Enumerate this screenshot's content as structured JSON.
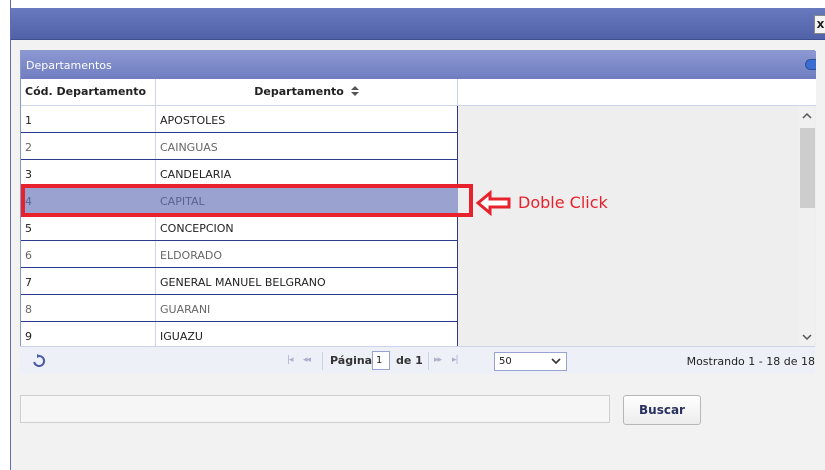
{
  "window": {
    "close_label": "x"
  },
  "grid": {
    "caption": "Departamentos",
    "columns": {
      "code": "Cód. Departamento",
      "name": "Departamento"
    },
    "rows": [
      {
        "code": "1",
        "name": "APOSTOLES"
      },
      {
        "code": "2",
        "name": "CAINGUAS"
      },
      {
        "code": "3",
        "name": "CANDELARIA"
      },
      {
        "code": "4",
        "name": "CAPITAL"
      },
      {
        "code": "5",
        "name": "CONCEPCION"
      },
      {
        "code": "6",
        "name": "ELDORADO"
      },
      {
        "code": "7",
        "name": "GENERAL MANUEL BELGRANO"
      },
      {
        "code": "8",
        "name": "GUARANI"
      },
      {
        "code": "9",
        "name": "IGUAZU"
      }
    ],
    "selected_row_index": 3
  },
  "annotation": {
    "text": "Doble Click",
    "color": "#e8222c"
  },
  "pager": {
    "page_label": "Página",
    "page_value": "1",
    "of_label": "de 1",
    "page_size": "50",
    "info": "Mostrando 1 - 18 de 18"
  },
  "search": {
    "value": "",
    "button_label": "Buscar"
  },
  "colors": {
    "header": "#6f7dc0",
    "selected_row": "#9aa3cf",
    "accent_red": "#e8222c"
  }
}
